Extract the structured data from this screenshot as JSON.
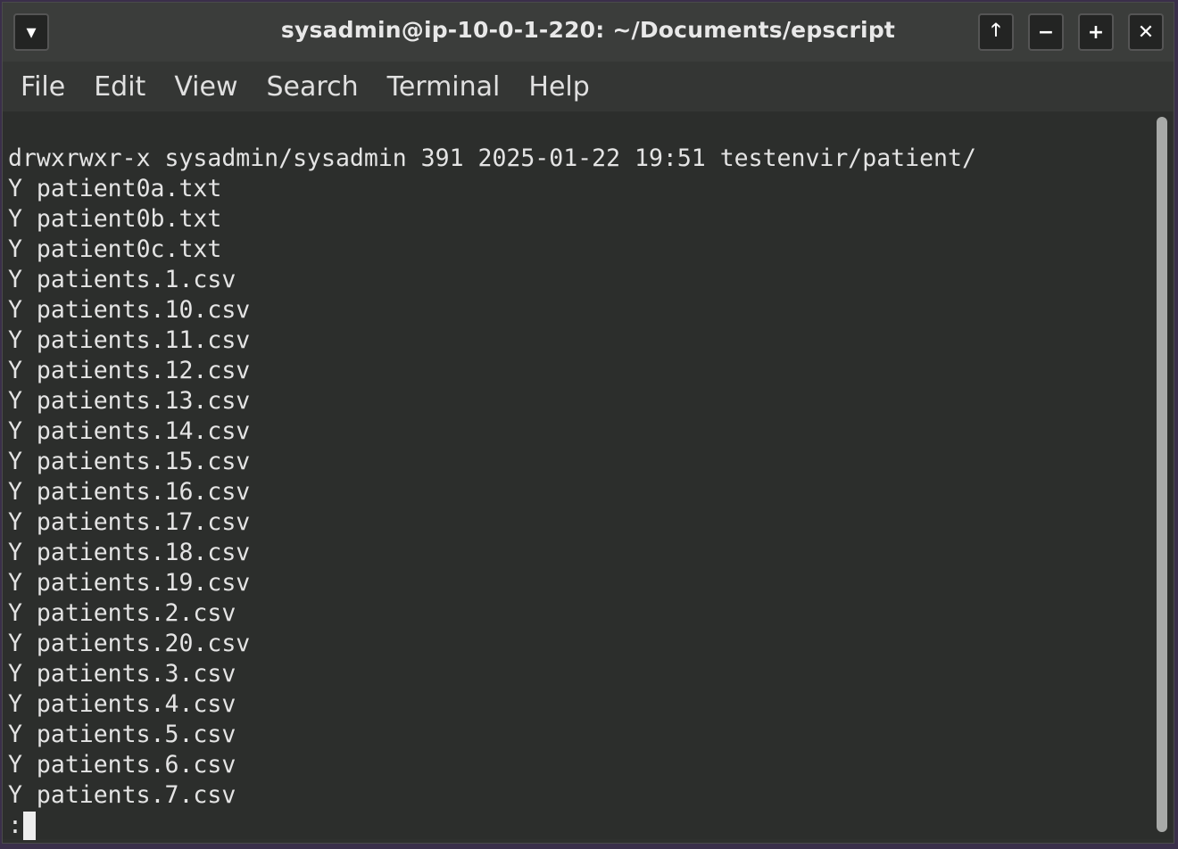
{
  "window": {
    "title": "sysadmin@ip-10-0-1-220: ~/Documents/epscript",
    "buttons": {
      "menu_icon": "▾",
      "raise_icon": "🡑",
      "minimize_icon": "−",
      "maximize_icon": "+",
      "close_icon": "✕"
    }
  },
  "menubar": {
    "items": [
      "File",
      "Edit",
      "View",
      "Search",
      "Terminal",
      "Help"
    ]
  },
  "terminal": {
    "lines": [
      "drwxrwxr-x sysadmin/sysadmin 391 2025-01-22 19:51 testenvir/patient/",
      "Y patient0a.txt",
      "Y patient0b.txt",
      "Y patient0c.txt",
      "Y patients.1.csv",
      "Y patients.10.csv",
      "Y patients.11.csv",
      "Y patients.12.csv",
      "Y patients.13.csv",
      "Y patients.14.csv",
      "Y patients.15.csv",
      "Y patients.16.csv",
      "Y patients.17.csv",
      "Y patients.18.csv",
      "Y patients.19.csv",
      "Y patients.2.csv",
      "Y patients.20.csv",
      "Y patients.3.csv",
      "Y patients.4.csv",
      "Y patients.5.csv",
      "Y patients.6.csv",
      "Y patients.7.csv"
    ],
    "prompt": ":"
  },
  "colors": {
    "terminal_bg": "#2c2e2c",
    "terminal_fg": "#e4e4e4",
    "titlebar_bg": "#3b3d3b"
  }
}
